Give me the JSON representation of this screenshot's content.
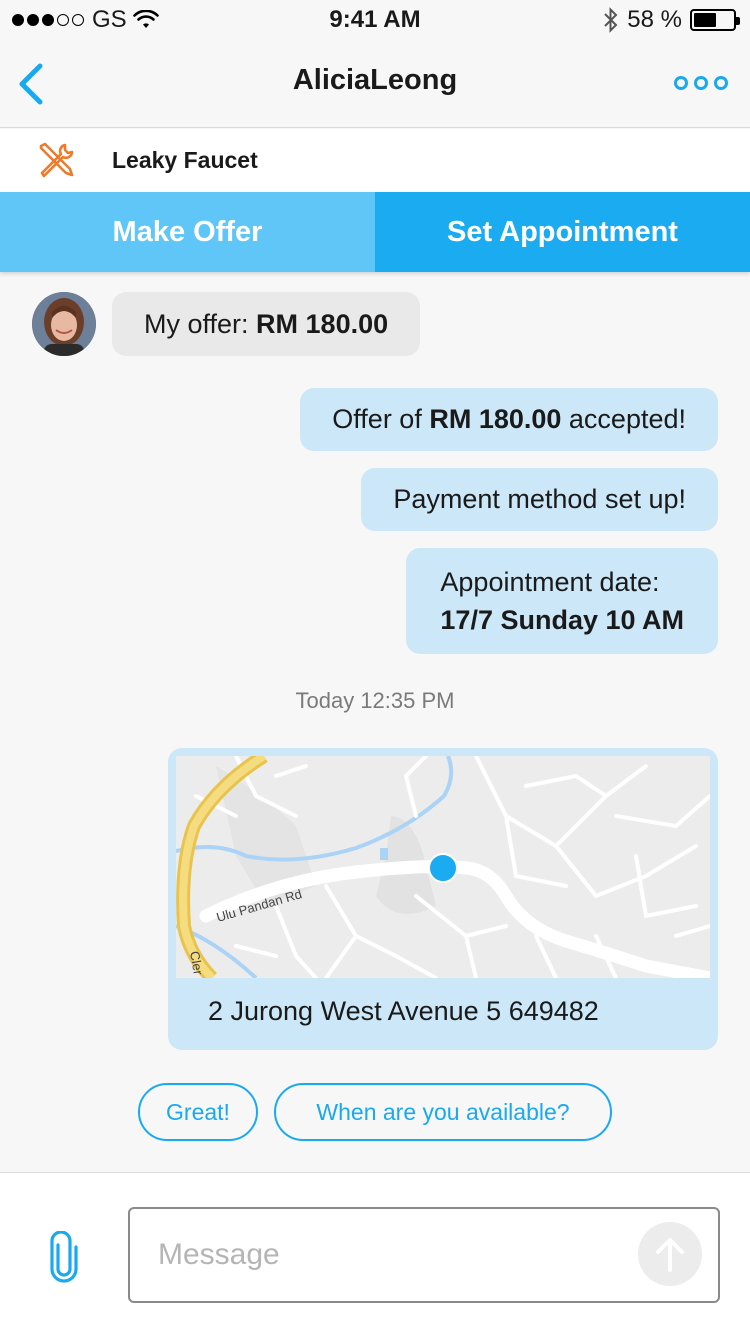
{
  "status_bar": {
    "carrier": "GS",
    "time": "9:41 AM",
    "battery_text": "58 %",
    "battery_level": 0.58,
    "signal_bars_filled": 3,
    "signal_bars_total": 5
  },
  "nav": {
    "title": "AliciaLeong"
  },
  "job": {
    "title": "Leaky Faucet",
    "icon": "tools-icon"
  },
  "actions": {
    "make_offer": "Make Offer",
    "set_appointment": "Set Appointment"
  },
  "messages": {
    "incoming_offer_prefix": "My offer: ",
    "incoming_offer_amount": "RM 180.00",
    "accepted_prefix": "Offer of ",
    "accepted_amount": "RM 180.00",
    "accepted_suffix": " accepted!",
    "payment": "Payment method set up!",
    "appointment_label": "Appointment date:",
    "appointment_value": "17/7 Sunday 10 AM",
    "timestamp": "Today 12:35 PM"
  },
  "map": {
    "road_label": "Ulu Pandan Rd",
    "road_label_2": "Cler",
    "address": "2 Jurong West Avenue 5 649482"
  },
  "quick_replies": [
    "Great!",
    "When are you available?"
  ],
  "composer": {
    "placeholder": "Message"
  },
  "colors": {
    "accent": "#19a9f0",
    "offer_button": "#5fc6f7",
    "appointment_button": "#1aabf0",
    "outgoing_bubble": "#cce7f7",
    "incoming_bubble": "#e9e9e9",
    "job_icon": "#f07a2a"
  }
}
